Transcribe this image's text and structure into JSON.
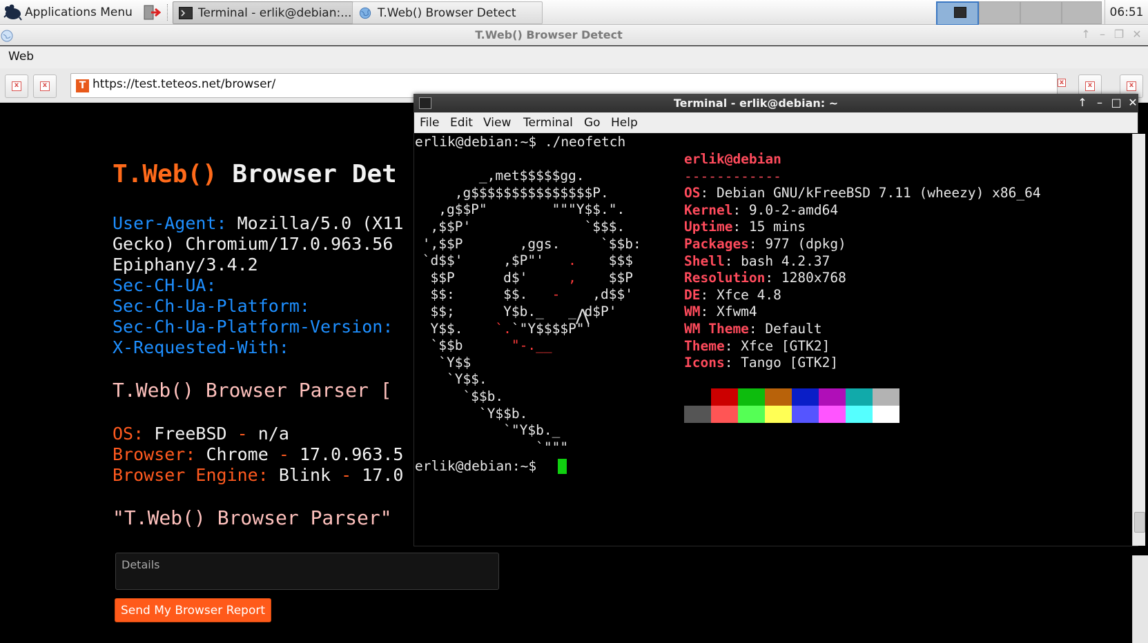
{
  "panel": {
    "app_menu_label": "Applications Menu",
    "tasks": [
      {
        "label": "Terminal - erlik@debian:..."
      },
      {
        "label": "T.Web() Browser Detect"
      }
    ],
    "clock": "06:51"
  },
  "browser": {
    "window_title": "T.Web() Browser Detect",
    "menu_web": "Web",
    "url": "https://test.teteos.net/browser/",
    "favicon_letter": "T"
  },
  "page": {
    "title_prefix": "T.Web()",
    "title_rest": " Browser Det",
    "ua_label": "User-Agent:",
    "ua_value": " Mozilla/5.0 (X11",
    "ua_line2": "Gecko) Chromium/17.0.963.56",
    "ua_line3": "Epiphany/3.4.2",
    "sec_ch_ua": "Sec-CH-UA:",
    "sec_ch_ua_platform": "Sec-Ch-Ua-Platform:",
    "sec_ch_ua_platform_version": "Sec-Ch-Ua-Platform-Version:",
    "x_requested_with": "X-Requested-With:",
    "parser_heading": "T.Web() Browser Parser [",
    "os_label": "OS:",
    "os_value": " FreeBSD ",
    "os_dash": "-",
    "os_version": " n/a",
    "browser_label": "Browser:",
    "browser_value": " Chrome ",
    "browser_dash": "-",
    "browser_version": " 17.0.963.5",
    "engine_label": "Browser Engine:",
    "engine_value": " Blink ",
    "engine_dash": "-",
    "engine_version": " 17.0",
    "quote_line": "\"T.Web() Browser Parser\"",
    "details_placeholder": "Details",
    "send_button": "Send My Browser Report"
  },
  "terminal": {
    "title": "Terminal - erlik@debian: ~",
    "menus": [
      "File",
      "Edit",
      "View",
      "Terminal",
      "Go",
      "Help"
    ],
    "command_line": "erlik@debian:~$ ./neofetch",
    "prompt": "erlik@debian:~$ ",
    "user_host": "erlik@debian",
    "separator": "------------",
    "info": [
      {
        "key": "OS",
        "value": ": Debian GNU/kFreeBSD 7.11 (wheezy) x86_64"
      },
      {
        "key": "Kernel",
        "value": ": 9.0-2-amd64"
      },
      {
        "key": "Uptime",
        "value": ": 15 mins"
      },
      {
        "key": "Packages",
        "value": ": 977 (dpkg)"
      },
      {
        "key": "Shell",
        "value": ": bash 4.2.37"
      },
      {
        "key": "Resolution",
        "value": ": 1280x768"
      },
      {
        "key": "DE",
        "value": ": Xfce 4.8"
      },
      {
        "key": "WM",
        "value": ": Xfwm4"
      },
      {
        "key": "WM Theme",
        "value": ": Default"
      },
      {
        "key": "Theme",
        "value": ": Xfce [GTK2]"
      },
      {
        "key": "Icons",
        "value": ": Tango [GTK2]"
      }
    ],
    "palette_top": [
      "#000000",
      "#cc0000",
      "#0dbc0d",
      "#b8620a",
      "#0a1ec7",
      "#b00eb8",
      "#11aaaa",
      "#b3b3b3"
    ],
    "palette_bottom": [
      "#555555",
      "#ff5555",
      "#55ff55",
      "#ffff55",
      "#5555ff",
      "#ff55ff",
      "#55ffff",
      "#ffffff"
    ],
    "cursor_color": "#10d010",
    "key_color": "#ff4b5c"
  },
  "colors": {
    "brand_orange": "#ff6a1a",
    "header_blue": "#1e8fff",
    "parser_pink": "#ffc1bd"
  }
}
